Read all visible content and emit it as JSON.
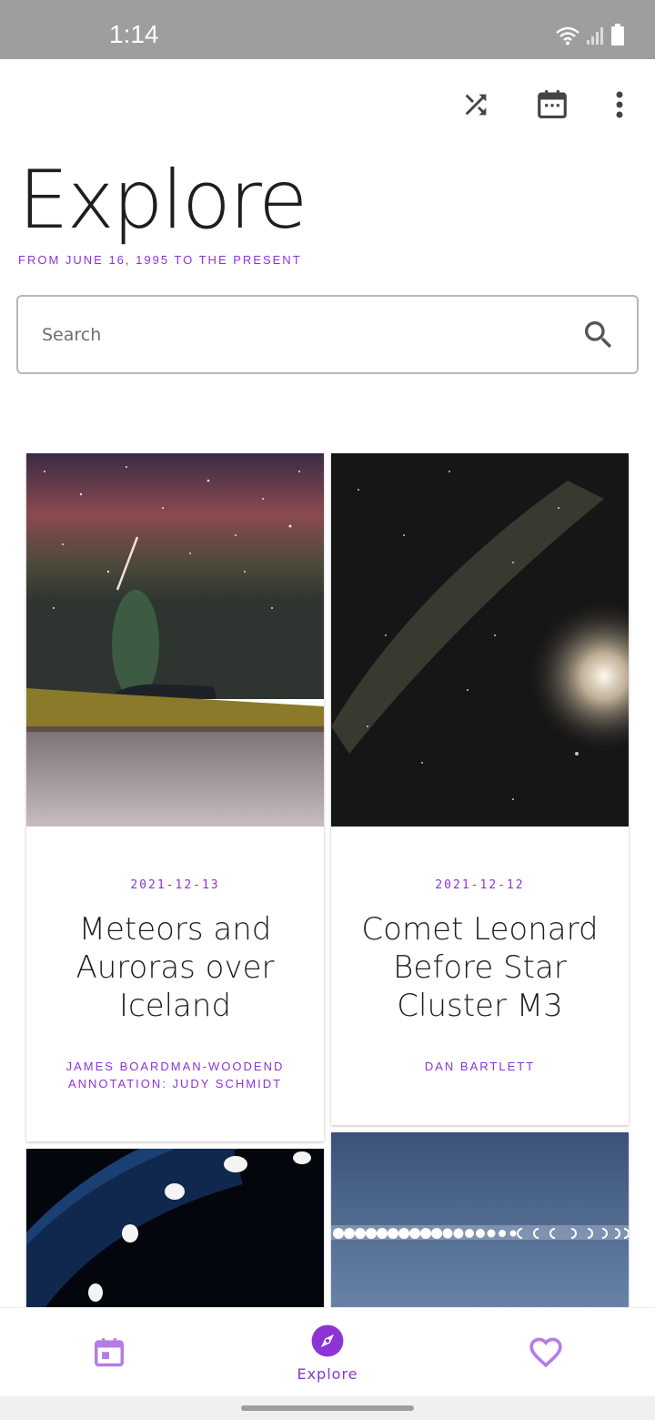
{
  "status_bar": {
    "time": "1:14"
  },
  "toolbar": {
    "shuffle_icon": "shuffle-icon",
    "calendar_icon": "calendar-icon",
    "more_icon": "more-vert-icon"
  },
  "header": {
    "title": "Explore",
    "subtitle": "FROM JUNE 16, 1995 TO THE PRESENT"
  },
  "search": {
    "placeholder": "Search"
  },
  "cards": [
    {
      "date": "2021-12-13",
      "title": "Meteors and Auroras over Iceland",
      "credit_line1": "JAMES BOARDMAN-WOODEND",
      "credit_line2": "ANNOTATION: JUDY SCHMIDT"
    },
    {
      "date": "2021-12-12",
      "title": "Comet Leonard Before Star Cluster M3",
      "credit_line1": "DAN BARTLETT",
      "credit_line2": ""
    }
  ],
  "bottom_nav": {
    "items": [
      {
        "icon": "calendar-today-icon",
        "label": ""
      },
      {
        "icon": "explore-compass-icon",
        "label": "Explore"
      },
      {
        "icon": "favorite-heart-icon",
        "label": ""
      }
    ]
  },
  "colors": {
    "accent": "#8d34d6",
    "nav_inactive": "#b57ce6",
    "status_bar": "#9e9e9e"
  }
}
